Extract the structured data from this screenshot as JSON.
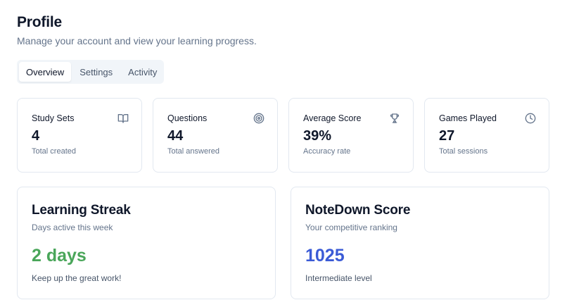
{
  "header": {
    "title": "Profile",
    "subtitle": "Manage your account and view your learning progress."
  },
  "tabs": [
    {
      "label": "Overview",
      "active": true
    },
    {
      "label": "Settings",
      "active": false
    },
    {
      "label": "Activity",
      "active": false
    }
  ],
  "stats": [
    {
      "label": "Study Sets",
      "value": "4",
      "sub": "Total created",
      "icon": "book-open-icon"
    },
    {
      "label": "Questions",
      "value": "44",
      "sub": "Total answered",
      "icon": "target-icon"
    },
    {
      "label": "Average Score",
      "value": "39%",
      "sub": "Accuracy rate",
      "icon": "trophy-icon"
    },
    {
      "label": "Games Played",
      "value": "27",
      "sub": "Total sessions",
      "icon": "clock-icon"
    }
  ],
  "streak": {
    "title": "Learning Streak",
    "description": "Days active this week",
    "value": "2 days",
    "note": "Keep up the great work!",
    "color": "#4aa65a"
  },
  "score": {
    "title": "NoteDown Score",
    "description": "Your competitive ranking",
    "value": "1025",
    "note": "Intermediate level",
    "color": "#3b5bd6"
  }
}
